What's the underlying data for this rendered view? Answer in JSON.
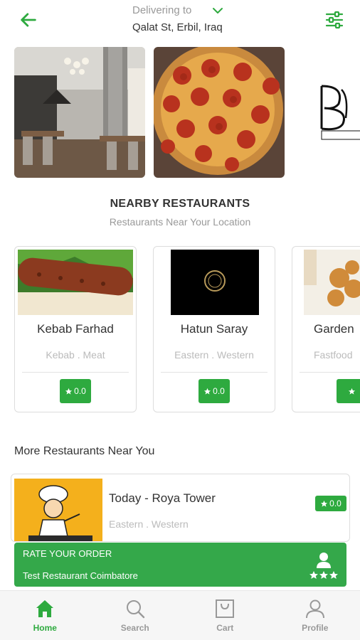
{
  "header": {
    "deliver_label": "Delivering to",
    "address": "Qalat St, Erbil, Iraq",
    "icons": [
      "arrow-left-icon",
      "chevron-down-icon",
      "sliders-icon"
    ],
    "accent_color": "#2eaa3f"
  },
  "nearby": {
    "title": "NEARBY RESTAURANTS",
    "subtitle": "Restaurants Near Your Location",
    "restaurants": [
      {
        "name": "Kebab Farhad",
        "cuisine": "Kebab . Meat",
        "rating": "0.0"
      },
      {
        "name": "Hatun Saray",
        "cuisine": "Eastern . Western",
        "rating": "0.0"
      },
      {
        "name": "Garden",
        "cuisine": "Fastfood",
        "rating": ""
      }
    ]
  },
  "more": {
    "title": "More Restaurants Near You",
    "items": [
      {
        "name": "Today - Roya Tower",
        "cuisine": "Eastern . Western",
        "rating": "0.0"
      }
    ]
  },
  "rate_order": {
    "title": "RATE YOUR ORDER",
    "restaurant": "Test Restaurant Coimbatore",
    "icon": "rating-user-icon"
  },
  "bottom_nav": {
    "items": [
      {
        "label": "Home",
        "icon": "home-icon",
        "active": true
      },
      {
        "label": "Search",
        "icon": "search-icon",
        "active": false
      },
      {
        "label": "Cart",
        "icon": "cart-bag-icon",
        "active": false
      },
      {
        "label": "Profile",
        "icon": "profile-icon",
        "active": false
      }
    ]
  }
}
